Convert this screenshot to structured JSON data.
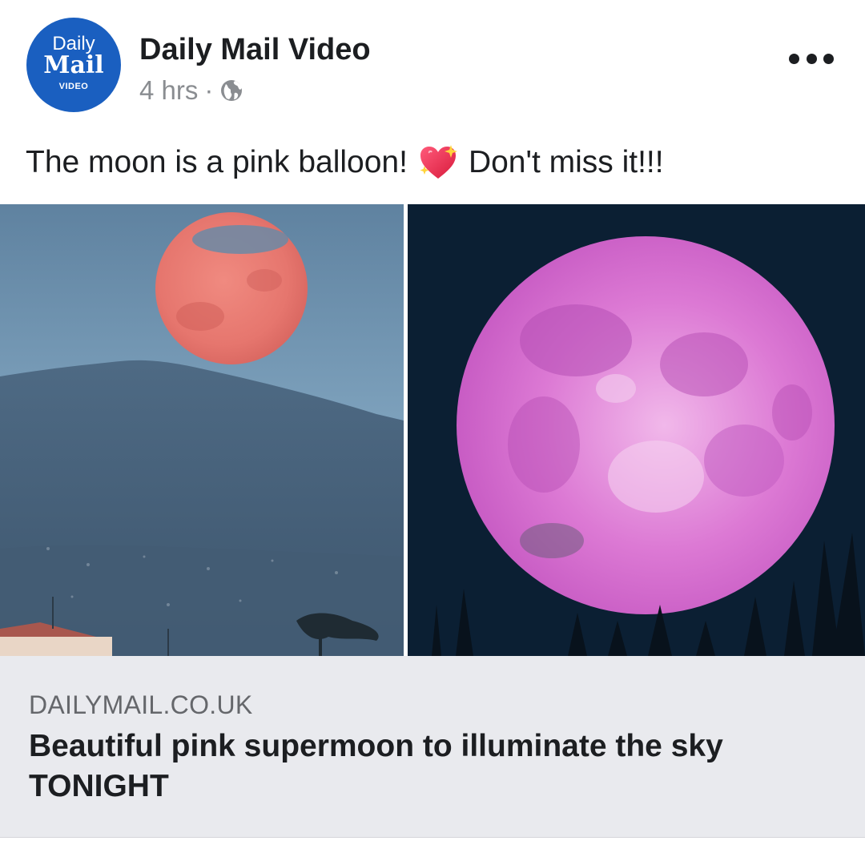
{
  "post": {
    "avatar": {
      "line1": "Daily",
      "line2": "Mail",
      "line3": "VIDEO"
    },
    "page_name": "Daily Mail Video",
    "time": "4 hrs",
    "separator": "·",
    "privacy_icon": "globe-icon",
    "more_icon": "more-options-icon",
    "caption_before": "The moon is a pink balloon!",
    "caption_emoji": "sparkling-heart-emoji",
    "caption_after": "Don't miss it!!!"
  },
  "images": {
    "left": "pink-moon-over-mountain-photo",
    "right": "pink-full-moon-over-trees-photo"
  },
  "link_preview": {
    "domain": "DAILYMAIL.CO.UK",
    "title": "Beautiful pink supermoon to illuminate the sky TONIGHT"
  },
  "colors": {
    "brand_blue": "#1a5fc0",
    "text": "#1c1e21",
    "muted": "#8a8d91",
    "link_bg": "#e9eaee"
  }
}
